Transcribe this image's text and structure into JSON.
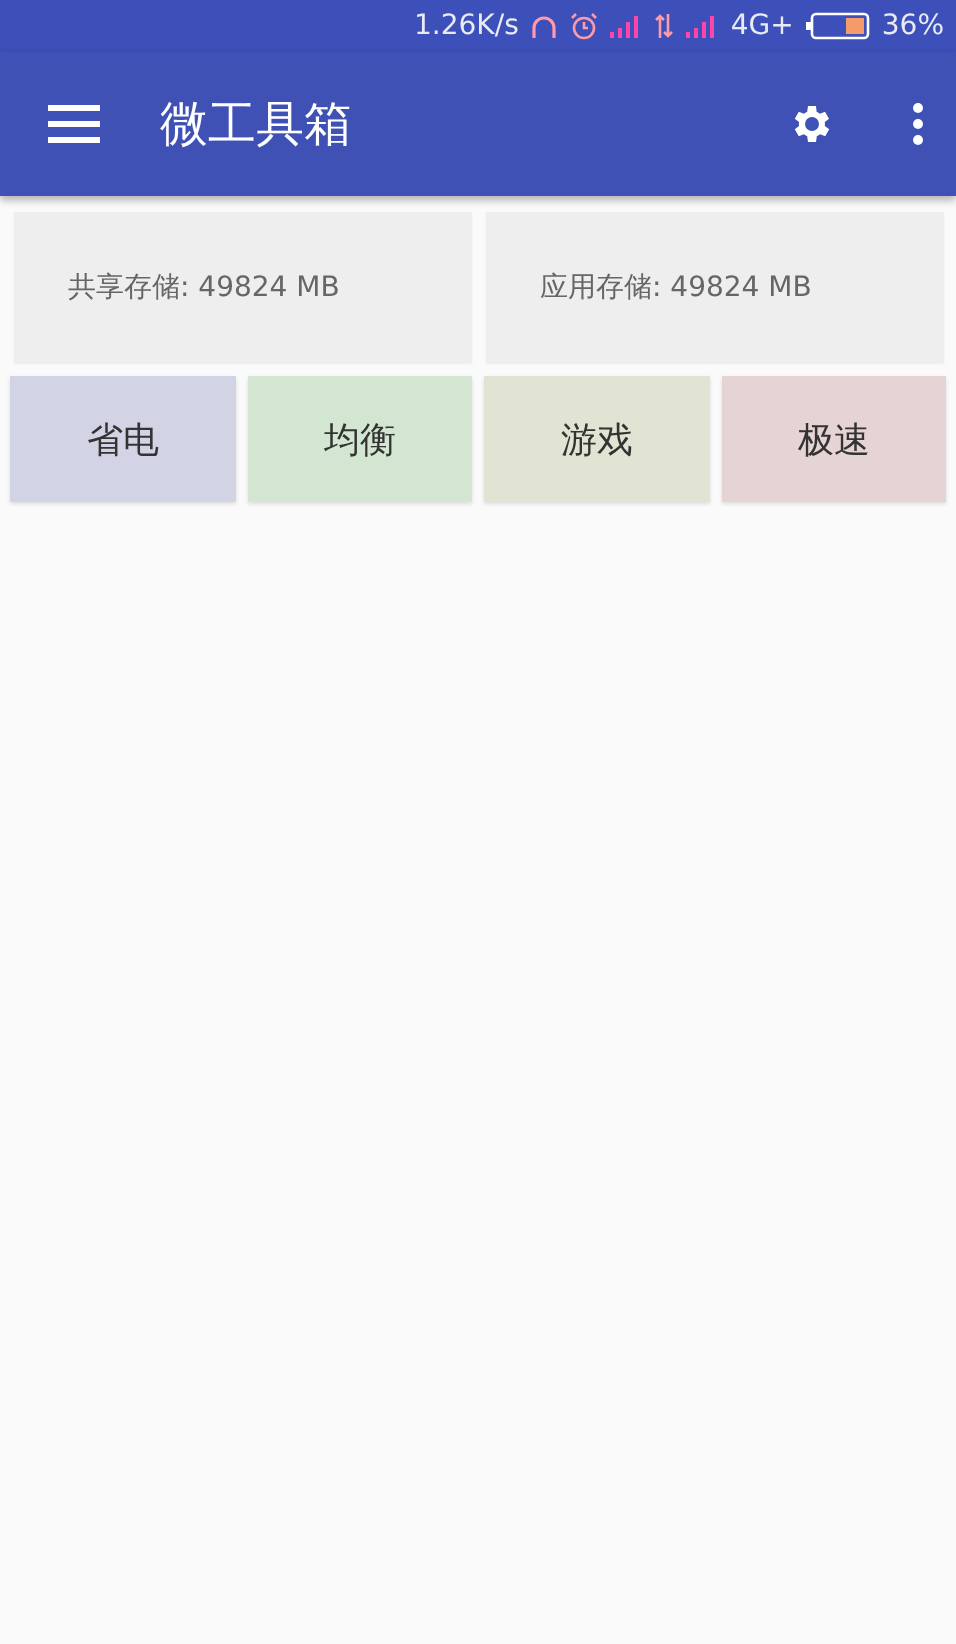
{
  "status_bar": {
    "speed": "1.26K/s",
    "network": "4G+",
    "battery": "36%"
  },
  "app_bar": {
    "title": "微工具箱"
  },
  "storage": [
    {
      "label": "共享存储: 49824 MB"
    },
    {
      "label": "应用存储: 49824 MB"
    }
  ],
  "modes": [
    {
      "label": "省电",
      "color": "#d3d3e6"
    },
    {
      "label": "均衡",
      "color": "#d2e6d2"
    },
    {
      "label": "游戏",
      "color": "#e2e4d3"
    },
    {
      "label": "极速",
      "color": "#e6d3d3"
    }
  ]
}
